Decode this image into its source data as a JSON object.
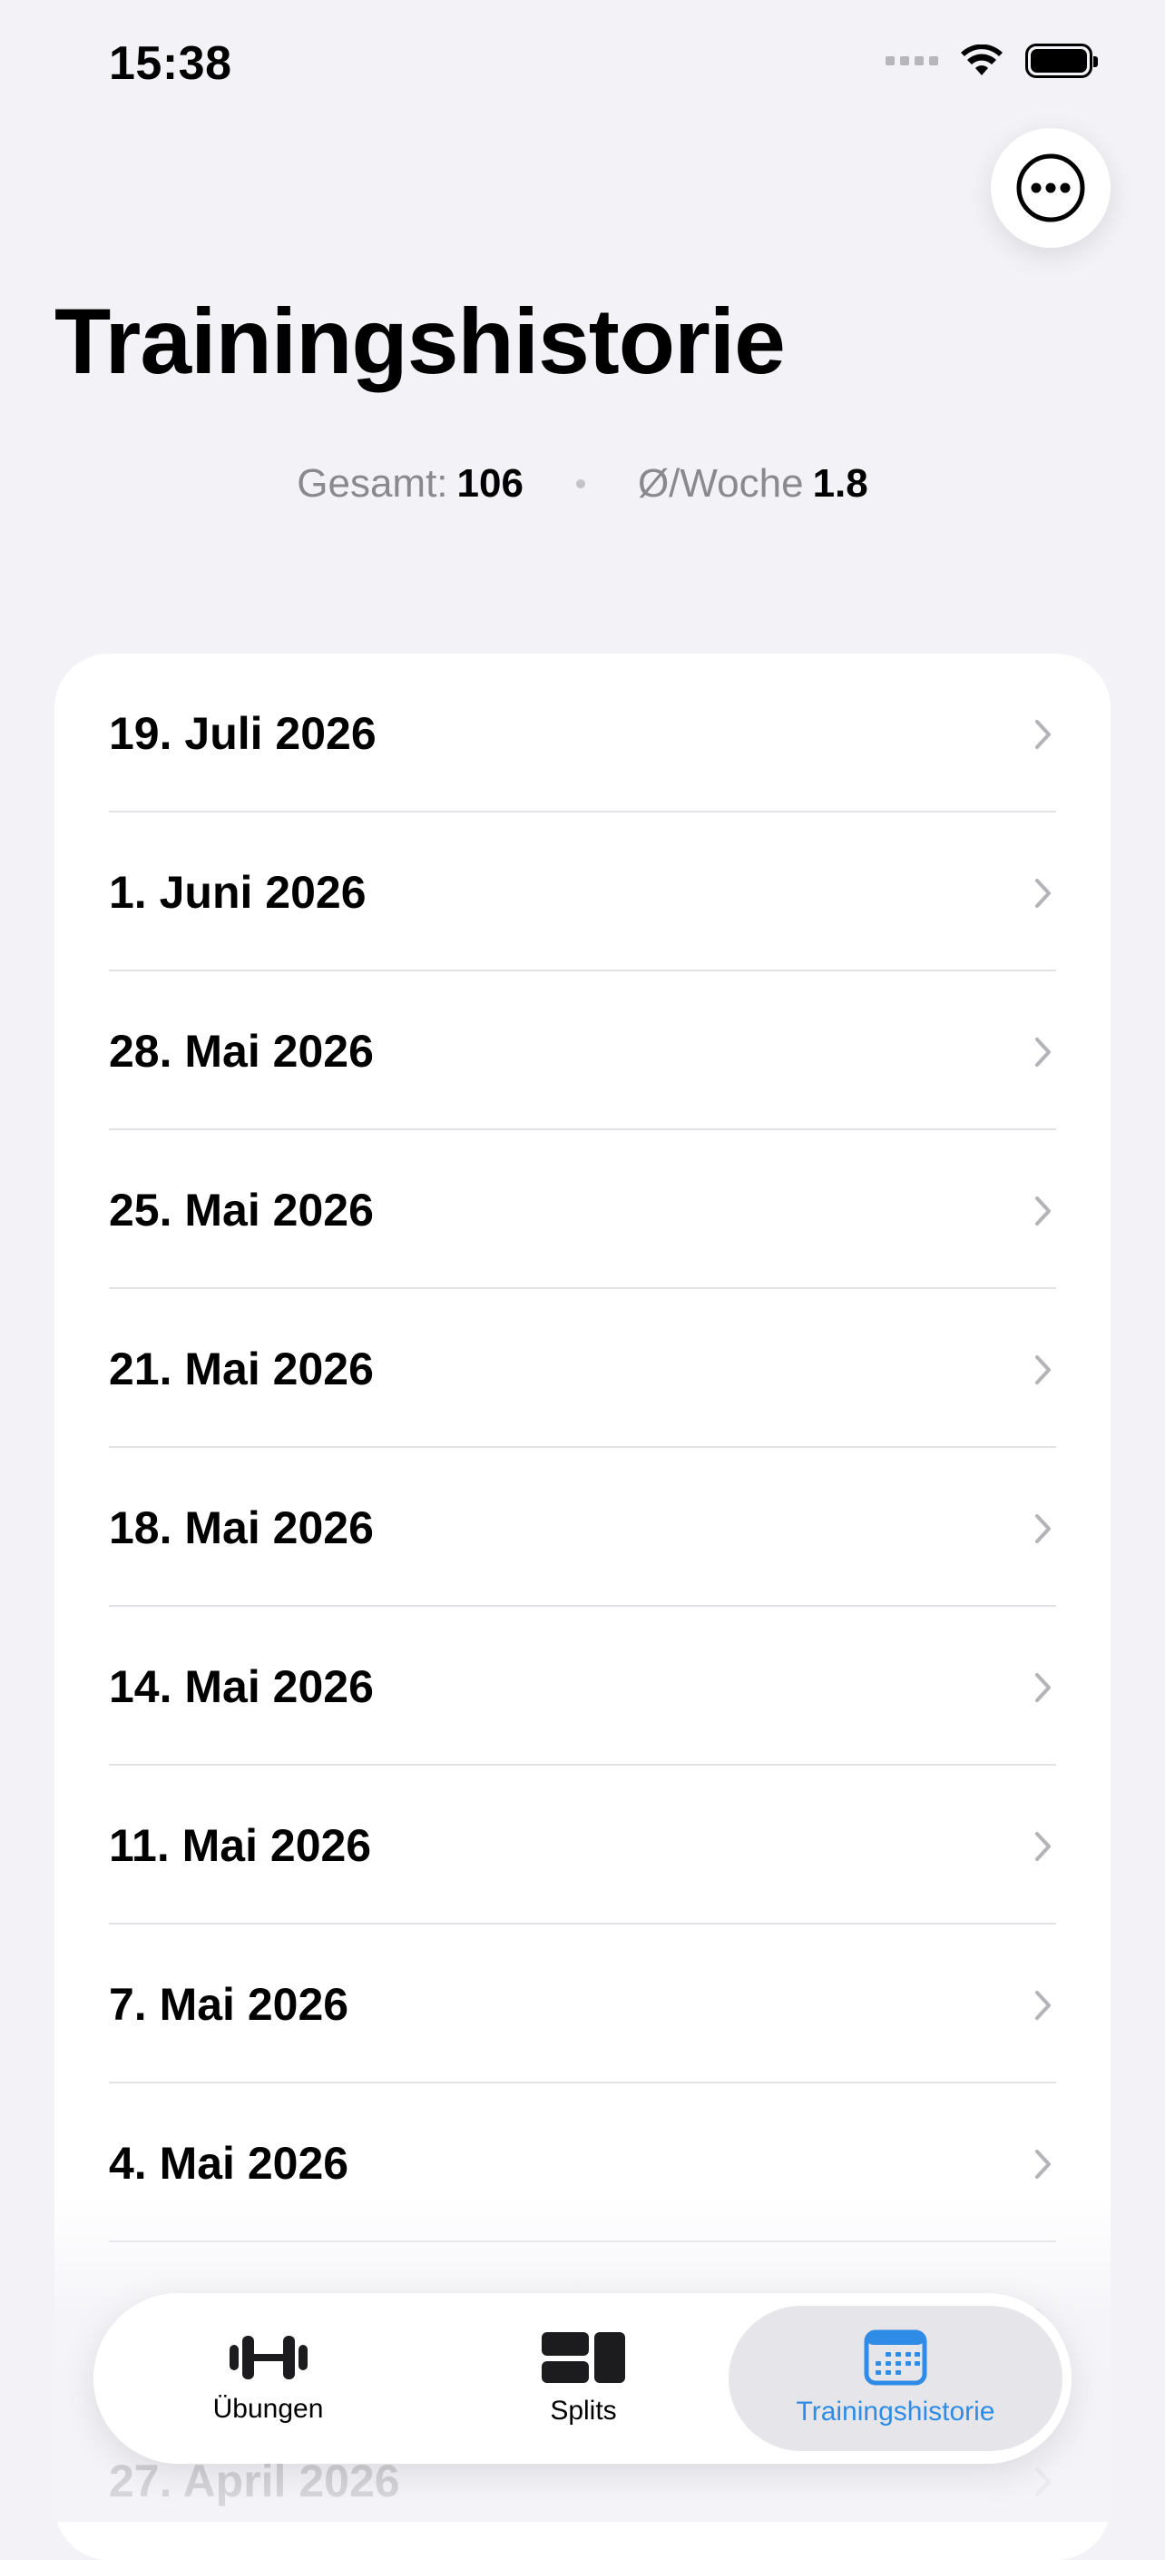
{
  "status_bar": {
    "time": "15:38"
  },
  "header": {
    "title": "Trainingshistorie",
    "more_icon": "ellipsis-circle-icon"
  },
  "stats": {
    "total_label": "Gesamt:",
    "total_value": "106",
    "weekly_label": "Ø/Woche",
    "weekly_value": "1.8"
  },
  "history": {
    "items": [
      {
        "label": "19. Juli 2026"
      },
      {
        "label": "1. Juni 2026"
      },
      {
        "label": "28. Mai 2026"
      },
      {
        "label": "25. Mai 2026"
      },
      {
        "label": "21. Mai 2026"
      },
      {
        "label": "18. Mai 2026"
      },
      {
        "label": "14. Mai 2026"
      },
      {
        "label": "11. Mai 2026"
      },
      {
        "label": "7. Mai 2026"
      },
      {
        "label": "4. Mai 2026"
      },
      {
        "label": ""
      },
      {
        "label": "27. April 2026"
      }
    ]
  },
  "tab_bar": {
    "tabs": [
      {
        "label": "Übungen",
        "icon": "dumbbell-icon"
      },
      {
        "label": "Splits",
        "icon": "splits-grid-icon"
      },
      {
        "label": "Trainingshistorie",
        "icon": "calendar-icon",
        "selected": true
      }
    ],
    "accent_color": "#2F8CE6"
  }
}
